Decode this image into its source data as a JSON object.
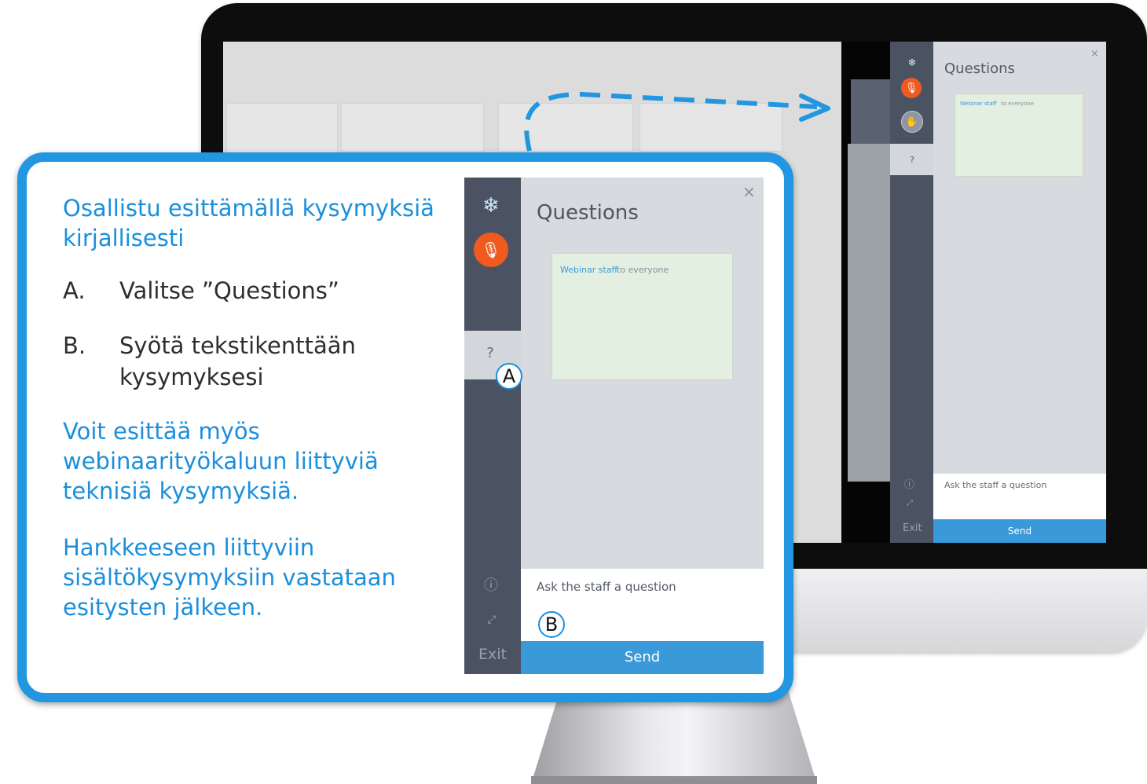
{
  "callout": {
    "intro": "Osallistu esittämällä kysymyksiä kirjallisesti",
    "steps": [
      {
        "marker": "A.",
        "text": "Valitse ”Questions”"
      },
      {
        "marker": "B.",
        "text_line1": "Syötä tekstikenttään",
        "text_line2": "kysymyksesi"
      }
    ],
    "note_technical": "Voit esittää myös webinaarityökaluun liittyviä teknisiä kysymyksiä.",
    "note_content": "Hankkeeseen liittyviin sisältökysymyksiin vastataan esitysten jälkeen."
  },
  "app": {
    "panel_title": "Questions",
    "message": {
      "from": "Webinar staff",
      "to": "to everyone"
    },
    "input_placeholder": "Ask the staff a question",
    "send_label": "Send",
    "exit_label": "Exit",
    "close_symbol": "×",
    "icons": [
      "logo-icon",
      "microphone-muted-icon",
      "raise-hand-icon",
      "question-icon",
      "info-icon",
      "expand-icon",
      "close-icon"
    ]
  },
  "markers": {
    "a": "A",
    "b": "B"
  },
  "colors": {
    "accent": "#1a8fdc",
    "send": "#3a9ad9",
    "mic": "#f05a1f",
    "sidebar": "#4b5363",
    "panel": "#d7dadf",
    "note": "#e3efe0"
  }
}
